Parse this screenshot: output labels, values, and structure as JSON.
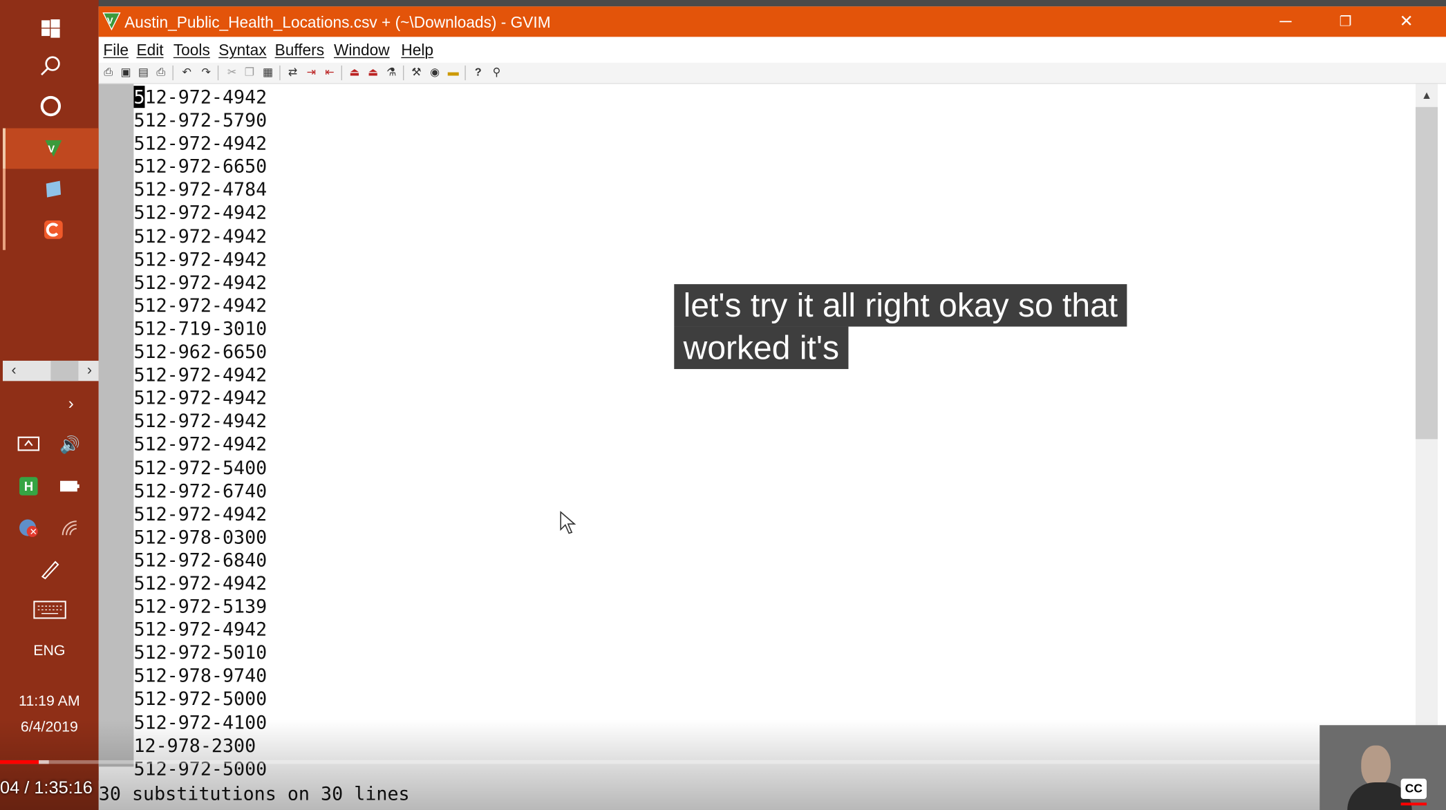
{
  "window": {
    "title": "Austin_Public_Health_Locations.csv + (~\\Downloads) - GVIM",
    "controls": {
      "minimize": "─",
      "restore": "❐",
      "close": "✕"
    }
  },
  "menu": [
    "File",
    "Edit",
    "Tools",
    "Syntax",
    "Buffers",
    "Window",
    "Help"
  ],
  "toolbar_icons": [
    "open-icon",
    "save-icon",
    "save-all-icon",
    "print-icon",
    "undo-icon",
    "redo-icon",
    "cut-icon",
    "copy-icon",
    "paste-icon",
    "replace-icon",
    "find-next-icon",
    "find-prev-icon",
    "load-session-icon",
    "save-session-icon",
    "run-script-icon",
    "make-icon",
    "shell-icon",
    "tags-icon",
    "help-icon",
    "find-help-icon"
  ],
  "editor": {
    "cursor_char": "5",
    "first_line_rest": "12-972-4942",
    "lines": [
      "512-972-5790",
      "512-972-4942",
      "512-972-6650",
      "512-972-4784",
      "512-972-4942",
      "512-972-4942",
      "512-972-4942",
      "512-972-4942",
      "512-972-4942",
      "512-719-3010",
      "512-962-6650",
      "512-972-4942",
      "512-972-4942",
      "512-972-4942",
      "512-972-4942",
      "512-972-5400",
      "512-972-6740",
      "512-972-4942",
      "512-978-0300",
      "512-972-6840",
      "512-972-4942",
      "512-972-5139",
      "512-972-4942",
      "512-972-5010",
      "512-978-9740",
      "512-972-5000",
      "512-972-4100",
      "12-978-2300",
      "512-972-5000"
    ],
    "command_line": "30 substitutions on 30 lines"
  },
  "taskbar": {
    "language": "ENG",
    "time": "11:19 AM",
    "date": "6/4/2019"
  },
  "video": {
    "caption_line1": "let's try it all right okay so that",
    "caption_line2": "worked it's",
    "timecode": "04 / 1:35:16",
    "played_fraction": 0.027,
    "loaded_fraction": 0.034,
    "cc_label": "CC"
  },
  "colors": {
    "titlebar": "#e3540a",
    "taskbar": "#8f2f17",
    "progress_played": "#ff0000"
  }
}
